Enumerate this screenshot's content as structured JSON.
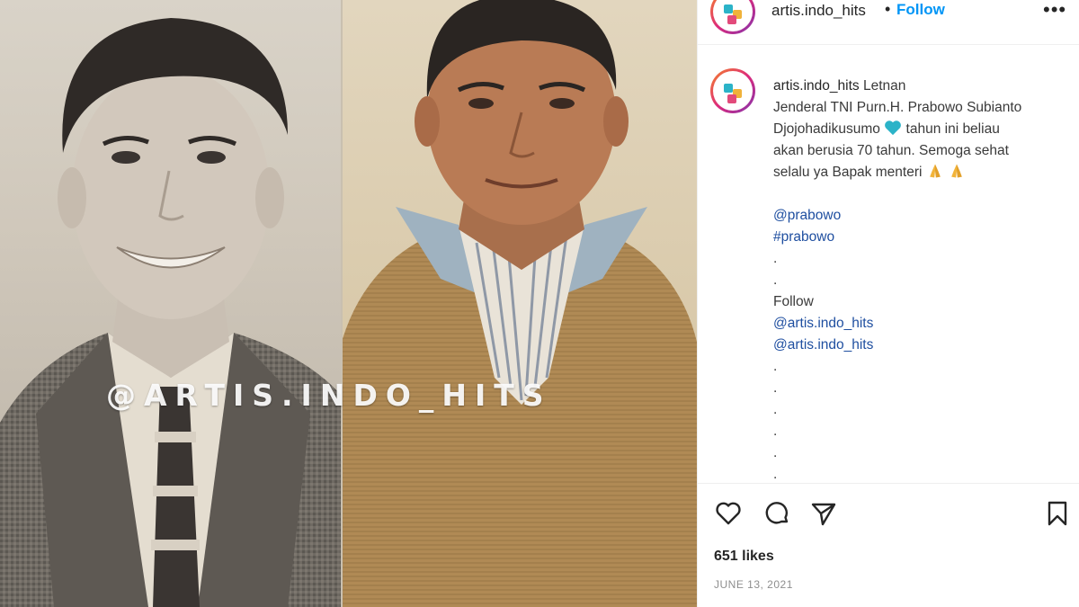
{
  "post": {
    "username": "artis.indo_hits",
    "follow_label": "Follow",
    "header_separator": "•",
    "more_label": "•••",
    "watermark": "@ARTIS.INDO_HITS",
    "caption": {
      "username": "artis.indo_hits",
      "line1": "Letnan",
      "line2": "Jenderal TNI Purn.H. Prabowo Subianto",
      "line3_start": "Djojohadikusumo",
      "line3_end": "tahun ini beliau",
      "line4": "akan berusia 70 tahun. Semoga sehat",
      "line5": "selalu ya Bapak menteri",
      "mention1": "@prabowo",
      "hashtag1": "#prabowo",
      "dot": ".",
      "follow_text": "Follow",
      "mention2": "@artis.indo_hits",
      "mention3": "@artis.indo_hits"
    },
    "likes": "651 likes",
    "date": "JUNE 13, 2021"
  },
  "icons": {
    "like": "heart-outline-icon",
    "comment": "speech-bubble-icon",
    "share": "paper-plane-icon",
    "save": "bookmark-icon",
    "emoji_heart": "blue-heart-emoji",
    "emoji_pray": "folded-hands-emoji"
  },
  "colors": {
    "follow_blue": "#0095f6",
    "link_blue": "#1f4fa0",
    "heart_emoji": "#2bb3c8",
    "pray_emoji": "#f2b43a"
  }
}
